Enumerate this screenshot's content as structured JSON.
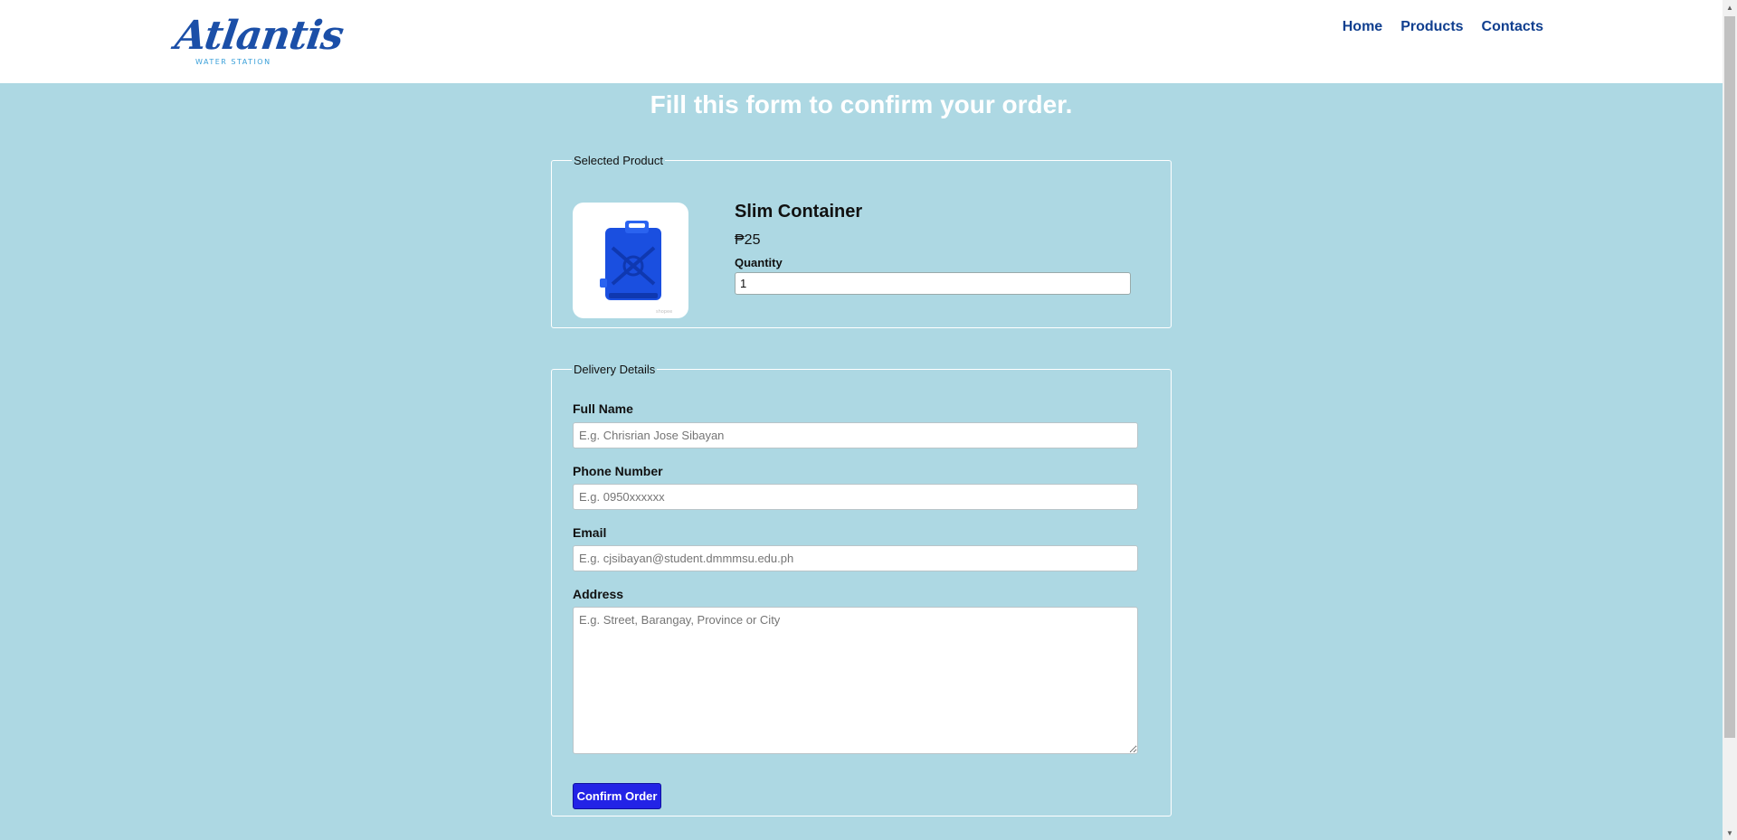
{
  "header": {
    "logo_text": "Atlantis",
    "logo_subtext": "WATER STATION",
    "nav": [
      "Home",
      "Products",
      "Contacts"
    ]
  },
  "page": {
    "title": "Fill this form to confirm your order."
  },
  "selected_product": {
    "legend": "Selected Product",
    "name": "Slim Container",
    "price": "₱25",
    "quantity_label": "Quantity",
    "quantity_value": "1"
  },
  "delivery": {
    "legend": "Delivery Details",
    "full_name_label": "Full Name",
    "full_name_placeholder": "E.g. Chrisrian Jose Sibayan",
    "phone_label": "Phone Number",
    "phone_placeholder": "E.g. 0950xxxxxx",
    "email_label": "Email",
    "email_placeholder": "E.g. cjsibayan@student.dmmmsu.edu.ph",
    "address_label": "Address",
    "address_placeholder": "E.g. Street, Barangay, Province or City",
    "confirm_label": "Confirm Order"
  },
  "colors": {
    "background": "#add8e3",
    "nav_link": "#103f8f",
    "button": "#2323e6",
    "product_blue": "#1a4fe0"
  }
}
